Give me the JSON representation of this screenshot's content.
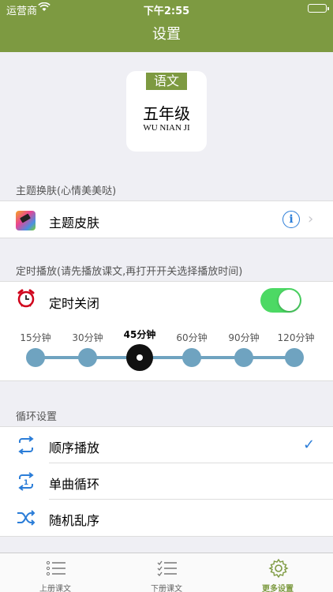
{
  "status_bar": {
    "carrier": "运营商",
    "time": "下午2:55"
  },
  "nav": {
    "title": "设置"
  },
  "book": {
    "subject": "语文",
    "grade": "五年级",
    "pinyin": "WU NIAN JI"
  },
  "theme_section": {
    "header": "主题换肤(心情美美哒)",
    "item_label": "主题皮肤",
    "info_icon": "i",
    "chevron": "›"
  },
  "timer_section": {
    "header": "定时播放(请先播放课文,再打开开关选择播放时间)",
    "item_label": "定时关闭",
    "switch_on": true,
    "options": [
      "15分钟",
      "30分钟",
      "45分钟",
      "60分钟",
      "90分钟",
      "120分钟"
    ],
    "selected": "45分钟",
    "accent_color": "#4cd964"
  },
  "loop_section": {
    "header": "循环设置",
    "items": [
      {
        "label": "顺序播放",
        "icon": "repeat-icon",
        "selected": true
      },
      {
        "label": "单曲循环",
        "icon": "repeat-one-icon",
        "selected": false
      },
      {
        "label": "随机乱序",
        "icon": "shuffle-icon",
        "selected": false
      }
    ],
    "checkmark": "✓"
  },
  "tab_bar": {
    "tabs": [
      {
        "label": "上册课文",
        "icon": "list-icon",
        "active": false
      },
      {
        "label": "下册课文",
        "icon": "checklist-icon",
        "active": false
      },
      {
        "label": "更多设置",
        "icon": "gear-icon",
        "active": true
      }
    ]
  },
  "colors": {
    "brand": "#7d9a41",
    "accent_blue": "#2b7dd8",
    "slider": "#6fa3c0"
  }
}
